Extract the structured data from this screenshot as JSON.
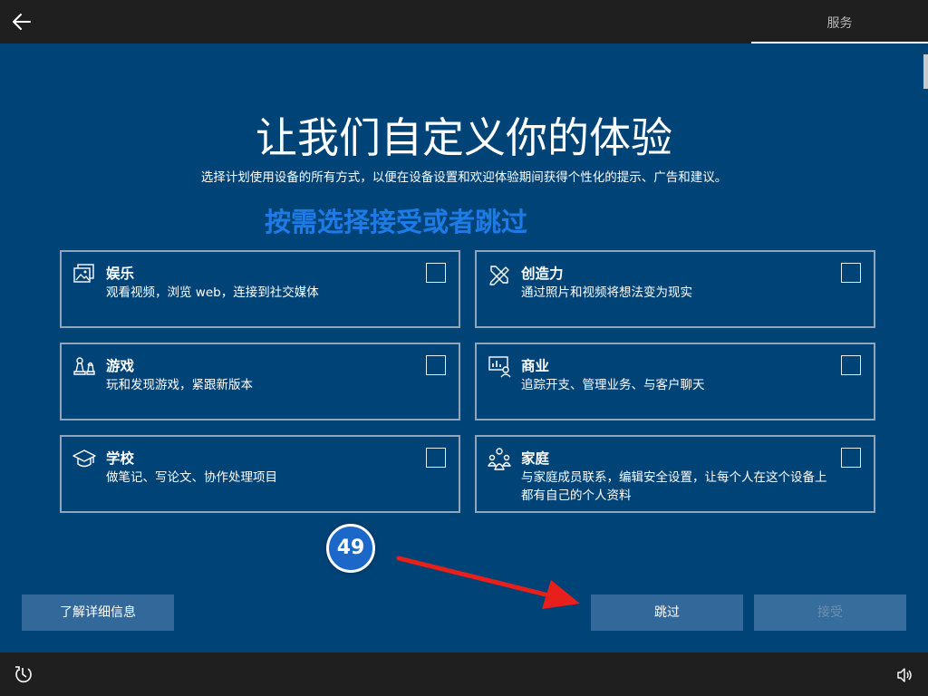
{
  "topbar": {
    "tab_label": "服务"
  },
  "title": "让我们自定义你的体验",
  "subtitle": "选择计划使用设备的所有方式，以便在设备设置和欢迎体验期间获得个性化的提示、广告和建议。",
  "annotation": {
    "text": "按需选择接受或者跳过",
    "badge": "49"
  },
  "cards": [
    {
      "title": "娱乐",
      "desc": "观看视频，浏览 web，连接到社交媒体",
      "icon": "media-icon",
      "checked": false
    },
    {
      "title": "创造力",
      "desc": "通过照片和视频将想法变为现实",
      "icon": "pen-tools-icon",
      "checked": false
    },
    {
      "title": "游戏",
      "desc": "玩和发现游戏，紧跟新版本",
      "icon": "chess-pieces-icon",
      "checked": false
    },
    {
      "title": "商业",
      "desc": "追踪开支、管理业务、与客户聊天",
      "icon": "business-presentation-icon",
      "checked": false
    },
    {
      "title": "学校",
      "desc": "做笔记、写论文、协作处理项目",
      "icon": "graduation-cap-icon",
      "checked": false
    },
    {
      "title": "家庭",
      "desc": "与家庭成员联系，编辑安全设置，让每个人在这个设备上都有自己的个人资料",
      "icon": "family-icon",
      "checked": false
    }
  ],
  "buttons": {
    "learn_more": "了解详细信息",
    "skip": "跳过",
    "accept": "接受"
  },
  "colors": {
    "background": "#004377",
    "bar": "#1f1f1f",
    "annotation_text": "#1e7be6",
    "annotation_arrow": "#e8201c",
    "badge": "#1b68c9",
    "button": "#33699a"
  }
}
